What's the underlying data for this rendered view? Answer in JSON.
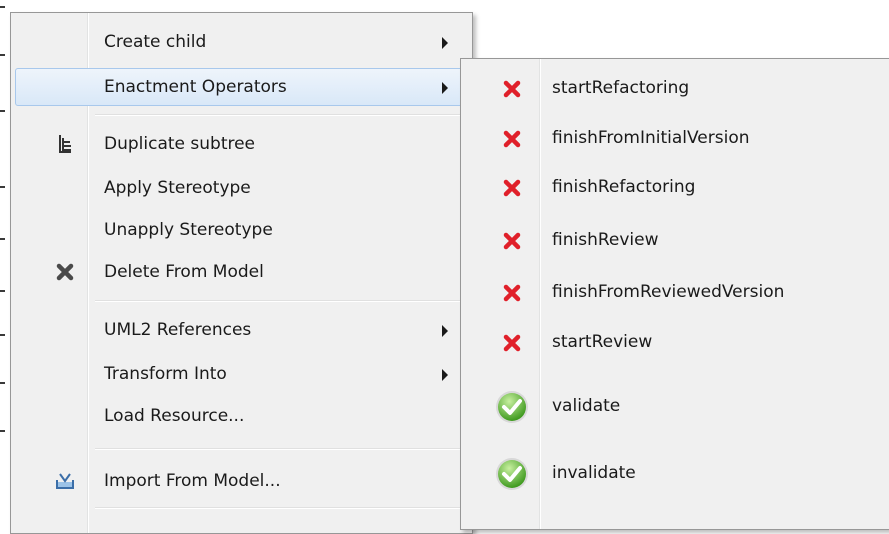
{
  "main_menu": {
    "items": [
      {
        "label": "Create child",
        "icon": "",
        "submenu": true
      },
      {
        "label": "Enactment Operators",
        "icon": "",
        "submenu": true,
        "highlighted": true
      },
      {
        "label": "Duplicate subtree",
        "icon": "tree-icon",
        "submenu": false
      },
      {
        "label": "Apply Stereotype",
        "icon": "",
        "submenu": false
      },
      {
        "label": "Unapply Stereotype",
        "icon": "",
        "submenu": false
      },
      {
        "label": "Delete From Model",
        "icon": "delete-x-icon",
        "submenu": false
      },
      {
        "label": "UML2 References",
        "icon": "",
        "submenu": true
      },
      {
        "label": "Transform Into",
        "icon": "",
        "submenu": true
      },
      {
        "label": "Load Resource...",
        "icon": "",
        "submenu": false
      },
      {
        "label": "Import From Model...",
        "icon": "import-icon",
        "submenu": false
      }
    ]
  },
  "submenu": {
    "items": [
      {
        "label": "startRefactoring",
        "icon": "red-x-icon"
      },
      {
        "label": "finishFromInitialVersion",
        "icon": "red-x-icon"
      },
      {
        "label": "finishRefactoring",
        "icon": "red-x-icon"
      },
      {
        "label": "finishReview",
        "icon": "red-x-icon"
      },
      {
        "label": "finishFromReviewedVersion",
        "icon": "red-x-icon"
      },
      {
        "label": "startReview",
        "icon": "red-x-icon"
      },
      {
        "label": "validate",
        "icon": "green-check-icon"
      },
      {
        "label": "invalidate",
        "icon": "green-check-icon"
      }
    ]
  },
  "colors": {
    "menu_bg": "#f0f0f0",
    "highlight": "#d9e8f8",
    "red_x": "#e0202a",
    "green_check": "#5cb832"
  }
}
